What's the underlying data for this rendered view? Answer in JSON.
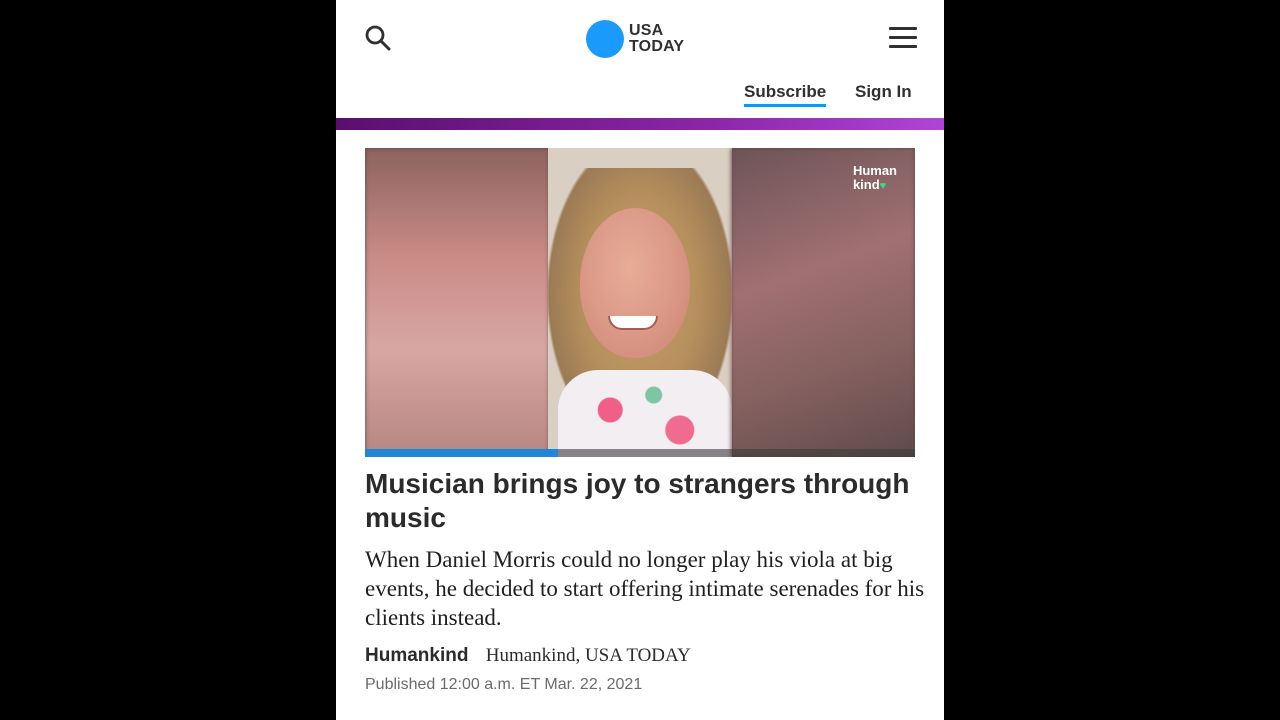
{
  "header": {
    "logo_line1": "USA",
    "logo_line2": "TODAY",
    "subscribe_label": "Subscribe",
    "signin_label": "Sign In"
  },
  "video": {
    "badge_line1": "Human",
    "badge_line2": "kind",
    "progress_percent": 35
  },
  "article": {
    "headline": "Musician brings joy to strangers through music",
    "summary": "When Daniel Morris could no longer play his viola at big events, he decided to start offering intimate serenades for his clients instead.",
    "brand": "Humankind",
    "author": "Humankind, USA TODAY",
    "published": "Published 12:00 a.m. ET Mar. 22, 2021"
  },
  "colors": {
    "logo_blue": "#1a9bfc",
    "accent_purple": "#8a25a6",
    "progress_blue": "#1e87d8"
  }
}
